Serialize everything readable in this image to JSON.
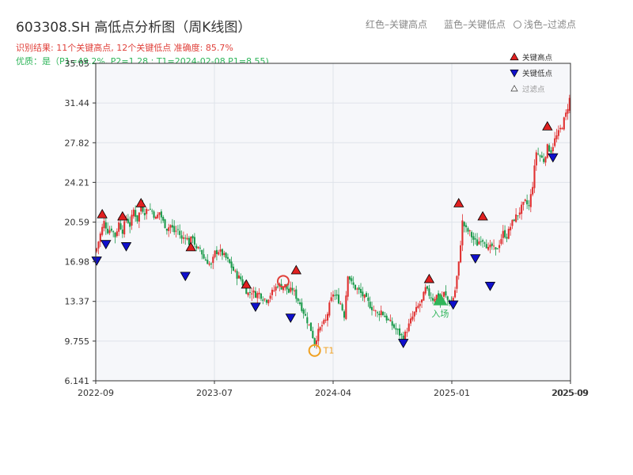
{
  "header": {
    "title": "603308.SH 高低点分析图（周K线图）",
    "result": "识别结果: 11个关键高点, 12个关键低点  准确度: 85.7%",
    "quality": "优质：是（P1=49.2%, P2=1.28 ; T1=2024-02-08 P1=8.55)"
  },
  "top_legend": {
    "red": "红色–关键高点",
    "blue": "蓝色–关键低点",
    "light": "浅色–过滤点"
  },
  "colors": {
    "up": "#e03030",
    "down": "#1a9a4a",
    "high": "#e02020",
    "low": "#1010cc",
    "t1": "#f0a020",
    "entry": "#2fb55a",
    "plot_bg": "#f6f7fa",
    "grid": "#dfe3ea"
  },
  "chart_data": {
    "type": "candlestick",
    "title": "603308.SH 高低点分析图（周K线图）",
    "ylim": [
      6.141,
      35.05
    ],
    "y_ticks": [
      "6.141",
      "9.755",
      "13.37",
      "16.98",
      "20.59",
      "24.21",
      "27.82",
      "31.44",
      "35.05"
    ],
    "y_tick_values": [
      6.141,
      9.755,
      13.37,
      16.98,
      20.59,
      24.21,
      27.82,
      31.44,
      35.05
    ],
    "x_ticks": [
      "2022-09",
      "2023-07",
      "2024-04",
      "2025-01",
      "2025-09"
    ],
    "x_tick_overlap": "2025-09",
    "grid": true,
    "legend": {
      "position": "top-right",
      "entries": [
        {
          "label": "关键高点",
          "marker": "red-up-triangle"
        },
        {
          "label": "关键低点",
          "marker": "blue-down-triangle"
        },
        {
          "label": "过滤点",
          "marker": "light-up-triangle"
        }
      ]
    },
    "path": [
      [
        0,
        18.2
      ],
      [
        2,
        19.5
      ],
      [
        4,
        20.6
      ],
      [
        6,
        19.8
      ],
      [
        8,
        20.0
      ],
      [
        10,
        19.3
      ],
      [
        12,
        20.5
      ],
      [
        14,
        19.8
      ],
      [
        16,
        21.0
      ],
      [
        18,
        20.3
      ],
      [
        20,
        21.7
      ],
      [
        22,
        20.8
      ],
      [
        24,
        22.0
      ],
      [
        26,
        21.5
      ],
      [
        28,
        21.9
      ],
      [
        30,
        21.6
      ],
      [
        32,
        20.9
      ],
      [
        34,
        21.5
      ],
      [
        36,
        20.6
      ],
      [
        38,
        20.0
      ],
      [
        40,
        20.3
      ],
      [
        42,
        19.7
      ],
      [
        44,
        19.9
      ],
      [
        46,
        19.0
      ],
      [
        48,
        19.4
      ],
      [
        50,
        18.7
      ],
      [
        52,
        19.3
      ],
      [
        54,
        18.0
      ],
      [
        56,
        18.2
      ],
      [
        58,
        17.3
      ],
      [
        60,
        17.0
      ],
      [
        62,
        16.6
      ],
      [
        64,
        17.8
      ],
      [
        66,
        18.0
      ],
      [
        68,
        17.7
      ],
      [
        70,
        17.3
      ],
      [
        72,
        16.8
      ],
      [
        74,
        16.2
      ],
      [
        76,
        15.7
      ],
      [
        78,
        15.4
      ],
      [
        80,
        14.6
      ],
      [
        82,
        14.1
      ],
      [
        84,
        14.3
      ],
      [
        86,
        14.0
      ],
      [
        88,
        14.1
      ],
      [
        90,
        13.7
      ],
      [
        92,
        13.5
      ],
      [
        94,
        14.0
      ],
      [
        96,
        14.4
      ],
      [
        98,
        14.9
      ],
      [
        100,
        14.7
      ],
      [
        102,
        14.8
      ],
      [
        104,
        14.2
      ],
      [
        106,
        14.5
      ],
      [
        108,
        13.8
      ],
      [
        110,
        13.2
      ],
      [
        112,
        12.4
      ],
      [
        114,
        11.6
      ],
      [
        116,
        10.8
      ],
      [
        118,
        9.6
      ],
      [
        120,
        10.6
      ],
      [
        122,
        11.2
      ],
      [
        124,
        11.6
      ],
      [
        126,
        13.0
      ],
      [
        128,
        14.1
      ],
      [
        130,
        13.7
      ],
      [
        132,
        13.2
      ],
      [
        134,
        12.1
      ],
      [
        136,
        15.9
      ],
      [
        138,
        15.0
      ],
      [
        140,
        14.6
      ],
      [
        142,
        14.3
      ],
      [
        144,
        13.9
      ],
      [
        146,
        13.5
      ],
      [
        148,
        13.0
      ],
      [
        150,
        12.6
      ],
      [
        152,
        12.2
      ],
      [
        154,
        12.5
      ],
      [
        156,
        12.0
      ],
      [
        158,
        11.6
      ],
      [
        160,
        11.2
      ],
      [
        162,
        10.8
      ],
      [
        164,
        10.4
      ],
      [
        166,
        10.0
      ],
      [
        168,
        10.8
      ],
      [
        170,
        11.6
      ],
      [
        172,
        12.3
      ],
      [
        174,
        12.9
      ],
      [
        176,
        13.4
      ],
      [
        178,
        14.5
      ],
      [
        180,
        14.0
      ],
      [
        182,
        13.6
      ],
      [
        184,
        13.9
      ],
      [
        186,
        13.4
      ],
      [
        188,
        14.1
      ],
      [
        190,
        13.5
      ],
      [
        192,
        13.1
      ],
      [
        194,
        14.4
      ],
      [
        196,
        16.8
      ],
      [
        198,
        20.6
      ],
      [
        200,
        19.9
      ],
      [
        202,
        19.6
      ],
      [
        204,
        19.0
      ],
      [
        206,
        18.6
      ],
      [
        208,
        19.1
      ],
      [
        210,
        18.9
      ],
      [
        212,
        18.1
      ],
      [
        214,
        18.4
      ],
      [
        216,
        17.9
      ],
      [
        218,
        18.7
      ],
      [
        220,
        19.6
      ],
      [
        222,
        19.3
      ],
      [
        224,
        20.2
      ],
      [
        226,
        20.9
      ],
      [
        228,
        21.3
      ],
      [
        230,
        21.9
      ],
      [
        232,
        22.4
      ],
      [
        234,
        22.0
      ],
      [
        236,
        24.0
      ],
      [
        238,
        27.0
      ],
      [
        240,
        26.6
      ],
      [
        242,
        26.2
      ],
      [
        244,
        27.4
      ],
      [
        246,
        27.1
      ],
      [
        248,
        28.1
      ],
      [
        250,
        28.7
      ],
      [
        252,
        29.4
      ],
      [
        254,
        30.4
      ],
      [
        256,
        31.8
      ]
    ],
    "highs": [
      {
        "i": 3,
        "y": 21.3
      },
      {
        "i": 14,
        "y": 21.1
      },
      {
        "i": 24,
        "y": 22.3
      },
      {
        "i": 51,
        "y": 18.3
      },
      {
        "i": 81,
        "y": 14.9
      },
      {
        "i": 108,
        "y": 16.2
      },
      {
        "i": 180,
        "y": 15.4
      },
      {
        "i": 196,
        "y": 22.3
      },
      {
        "i": 209,
        "y": 21.1
      },
      {
        "i": 244,
        "y": 29.3
      }
    ],
    "lows": [
      {
        "i": 0,
        "y": 17.1
      },
      {
        "i": 5,
        "y": 18.6
      },
      {
        "i": 16,
        "y": 18.4
      },
      {
        "i": 48,
        "y": 15.7
      },
      {
        "i": 86,
        "y": 12.9
      },
      {
        "i": 105,
        "y": 11.9
      },
      {
        "i": 166,
        "y": 9.6
      },
      {
        "i": 193,
        "y": 13.1
      },
      {
        "i": 205,
        "y": 17.3
      },
      {
        "i": 213,
        "y": 14.8
      },
      {
        "i": 247,
        "y": 26.5
      }
    ],
    "t1": {
      "label": "T1",
      "i": 118,
      "y": 8.9
    },
    "t1_high": {
      "i": 101,
      "y": 15.2
    },
    "entry": {
      "label": "入场",
      "i": 186,
      "y": 13.5
    }
  }
}
